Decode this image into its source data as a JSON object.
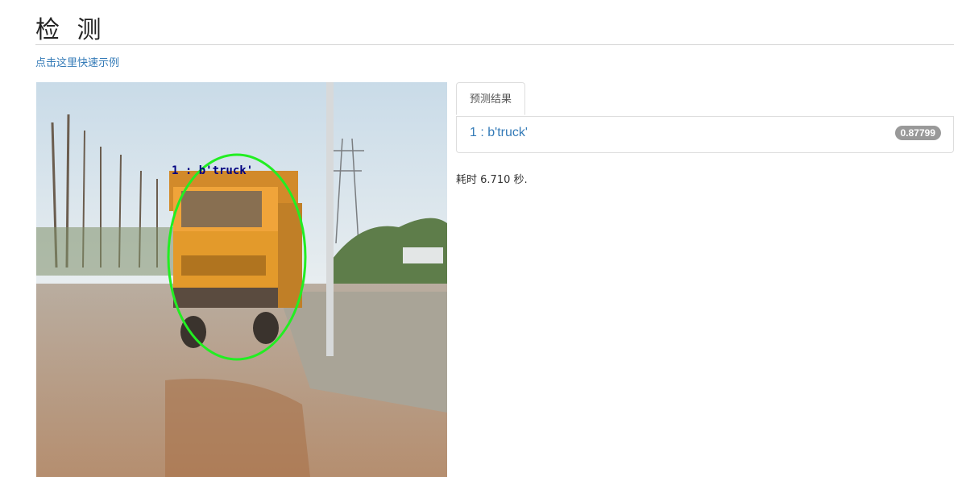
{
  "header": {
    "title": "检 测",
    "demo_link": "点击这里快速示例"
  },
  "image": {
    "overlay_label": "1 : b'truck'",
    "ellipse_color": "#22ee22",
    "label_color": "#000080"
  },
  "results": {
    "tab_label": "预测结果",
    "items": [
      {
        "label": "1 : b'truck'",
        "score": "0.87799"
      }
    ],
    "timing_prefix": "耗时",
    "timing_value": "6.710",
    "timing_suffix": "秒."
  },
  "colors": {
    "link": "#337ab7",
    "badge": "#999999"
  }
}
